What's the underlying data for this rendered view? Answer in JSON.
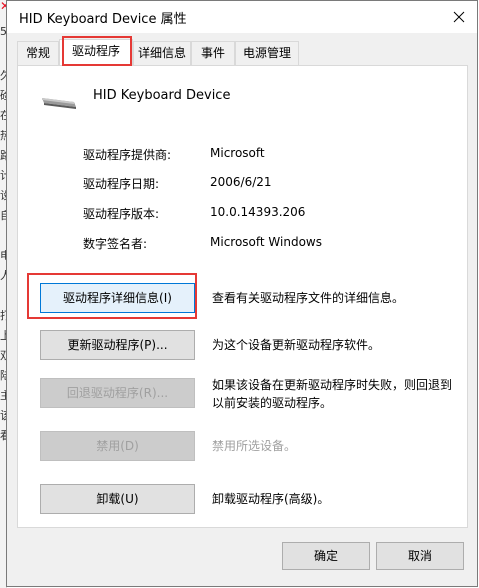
{
  "background": {
    "chars": [
      "5",
      "久",
      "硷",
      "在",
      "热",
      "路",
      "计",
      "设",
      "自",
      "电",
      "人",
      "打",
      "上",
      "双",
      "陆",
      "主",
      "该",
      "看"
    ]
  },
  "window": {
    "title": "HID Keyboard Device 属性"
  },
  "tabs": [
    {
      "label": "常规"
    },
    {
      "label": "驱动程序"
    },
    {
      "label": "详细信息"
    },
    {
      "label": "事件"
    },
    {
      "label": "电源管理"
    }
  ],
  "device": {
    "name": "HID Keyboard Device",
    "icon": "keyboard-icon"
  },
  "info": [
    {
      "label": "驱动程序提供商:",
      "value": "Microsoft"
    },
    {
      "label": "驱动程序日期:",
      "value": "2006/6/21"
    },
    {
      "label": "驱动程序版本:",
      "value": "10.0.14393.206"
    },
    {
      "label": "数字签名者:",
      "value": "Microsoft Windows"
    }
  ],
  "actions": [
    {
      "button": "驱动程序详细信息(I)",
      "desc": "查看有关驱动程序文件的详细信息。",
      "enabled": true
    },
    {
      "button": "更新驱动程序(P)...",
      "desc": "为这个设备更新驱动程序软件。",
      "enabled": true
    },
    {
      "button": "回退驱动程序(R)...",
      "desc": "如果该设备在更新驱动程序时失败，则回退到以前安装的驱动程序。",
      "enabled": false
    },
    {
      "button": "禁用(D)",
      "desc": "禁用所选设备。",
      "enabled": false
    },
    {
      "button": "卸载(U)",
      "desc": "卸载驱动程序(高级)。",
      "enabled": true
    }
  ],
  "footer": {
    "ok": "确定",
    "cancel": "取消"
  },
  "colors": {
    "highlight": "#e53935",
    "focus_border": "#0078d7"
  }
}
